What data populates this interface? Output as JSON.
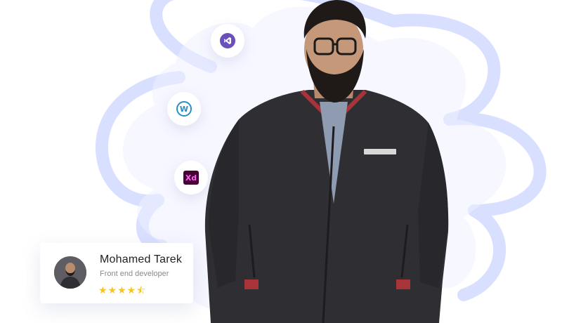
{
  "icons": {
    "visual_studio": "visual-studio-icon",
    "wordpress": "wordpress-icon",
    "xd": "adobe-xd-icon"
  },
  "icon_text": {
    "wordpress": "W",
    "xd": "Xd"
  },
  "profile": {
    "name": "Mohamed Tarek",
    "role": "Front end developer",
    "rating": 4.5,
    "stars": "★★★★⯪"
  },
  "colors": {
    "blob": "#d6deff",
    "vs": "#6b4fbb",
    "wordpress": "#2a8fbf",
    "xd_bg": "#470137",
    "xd_text": "#ff61f6",
    "star": "#f6c61e"
  }
}
